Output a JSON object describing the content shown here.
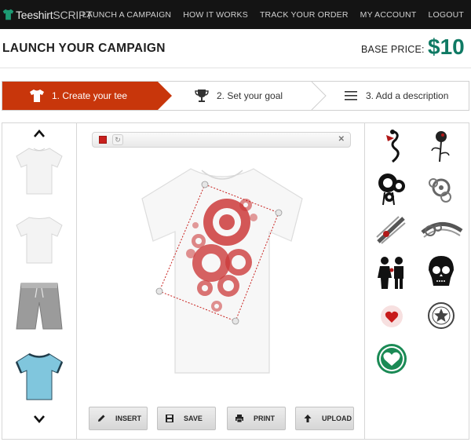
{
  "brand": {
    "name_bold": "Teeshirt",
    "name_light": "SCRIPT"
  },
  "nav": {
    "items": [
      "LAUNCH A CAMPAIGN",
      "HOW IT WORKS",
      "TRACK YOUR ORDER",
      "MY ACCOUNT",
      "LOGOUT"
    ]
  },
  "header": {
    "title": "LAUNCH YOUR CAMPAIGN",
    "base_price_label": "BASE PRICE:",
    "base_price_value": "$10"
  },
  "steps": [
    {
      "label": "1. Create your tee",
      "icon": "tshirt-icon",
      "active": true
    },
    {
      "label": "2. Set your goal",
      "icon": "trophy-icon",
      "active": false
    },
    {
      "label": "3. Add a description",
      "icon": "list-icon",
      "active": false
    }
  ],
  "products": [
    {
      "name": "white-tshirt-front",
      "color": "#f2f2f2"
    },
    {
      "name": "white-tshirt-back",
      "color": "#f2f2f2"
    },
    {
      "name": "grey-shorts",
      "color": "#9a9a9a"
    },
    {
      "name": "blue-ringer-tshirt",
      "color": "#7cc5dc"
    }
  ],
  "design_toolbar": {
    "selected_color": "#c8201d"
  },
  "actions": {
    "insert": "INSERT",
    "save": "SAVE",
    "print": "PRINT",
    "upload": "UPLOAD"
  },
  "artwork": [
    "dragon-icon",
    "rose-icon",
    "circles-icon",
    "gears-icon",
    "wings-icon",
    "winged-circles-icon",
    "couple-icon",
    "skull-icon",
    "heart-icon",
    "star-badge-icon",
    "green-heart-icon"
  ],
  "colors": {
    "accent": "#c8360b",
    "price": "#0f7a64",
    "topbar": "#141414"
  }
}
